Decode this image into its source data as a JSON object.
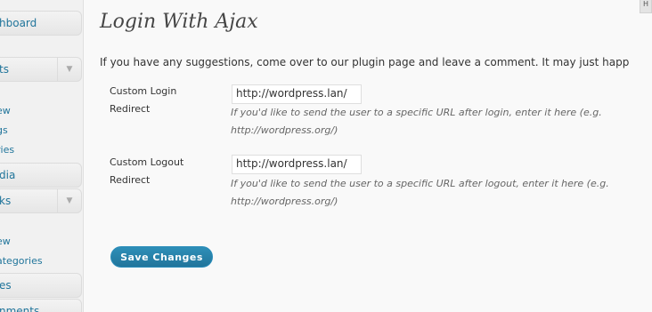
{
  "sidebar": {
    "dashboard": "hboard",
    "section1": {
      "label": "ts",
      "items": [
        "ew",
        "gs",
        "ries"
      ]
    },
    "media": "dia",
    "section2": {
      "label": "ks",
      "items": [
        "ew",
        "ategories"
      ]
    },
    "pages": "es",
    "comments": "nments"
  },
  "help_label": "H",
  "page": {
    "title": "Login With Ajax",
    "intro": "If you have any suggestions, come over to our plugin page and leave a comment. It may just happ",
    "login": {
      "label": "Custom Login Redirect",
      "value": "http://wordpress.lan/",
      "description": "If you'd like to send the user to a specific URL after login, enter it here (e.g. http://wordpress.org/)"
    },
    "logout": {
      "label": "Custom Logout Redirect",
      "value": "http://wordpress.lan/",
      "description": "If you'd like to send the user to a specific URL after logout, enter it here (e.g. http://wordpress.org/)"
    },
    "save_label": "Save Changes"
  },
  "icons": {
    "collapse": "triangle-down-icon"
  },
  "colors": {
    "link": "#21759b",
    "button": "#21759b",
    "background": "#f9f9f9"
  }
}
